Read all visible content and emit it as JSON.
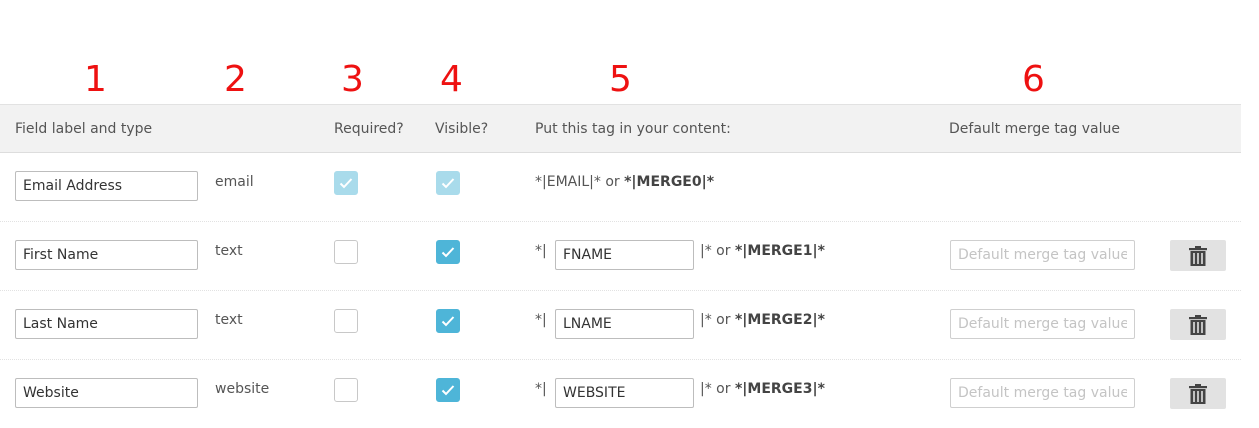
{
  "annotations": [
    "1",
    "2",
    "3",
    "4",
    "5",
    "6"
  ],
  "header": {
    "field_label": "Field label and type",
    "required": "Required?",
    "visible": "Visible?",
    "tag": "Put this tag in your content:",
    "default": "Default merge tag value"
  },
  "rows": [
    {
      "label": "Email Address",
      "type": "email",
      "required": true,
      "visible": true,
      "locked": true,
      "tag_full": "*|EMAIL|*",
      "or": "or",
      "merge": "*|MERGE0|*"
    },
    {
      "label": "First Name",
      "type": "text",
      "required": false,
      "visible": true,
      "tag_prefix": "*|",
      "tag": "FNAME",
      "tag_suffix": "|*",
      "or": "or",
      "merge": "*|MERGE1|*",
      "default_placeholder": "Default merge tag value"
    },
    {
      "label": "Last Name",
      "type": "text",
      "required": false,
      "visible": true,
      "tag_prefix": "*|",
      "tag": "LNAME",
      "tag_suffix": "|*",
      "or": "or",
      "merge": "*|MERGE2|*",
      "default_placeholder": "Default merge tag value"
    },
    {
      "label": "Website",
      "type": "website",
      "required": false,
      "visible": true,
      "tag_prefix": "*|",
      "tag": "WEBSITE",
      "tag_suffix": "|*",
      "or": "or",
      "merge": "*|MERGE3|*",
      "default_placeholder": "Default merge tag value"
    }
  ],
  "icons": {
    "check": "check-icon",
    "delete": "trash-icon"
  },
  "colors": {
    "annotation": "#ee1111",
    "checked": "#4eb5d8",
    "checked_disabled": "#a9dbeb"
  }
}
